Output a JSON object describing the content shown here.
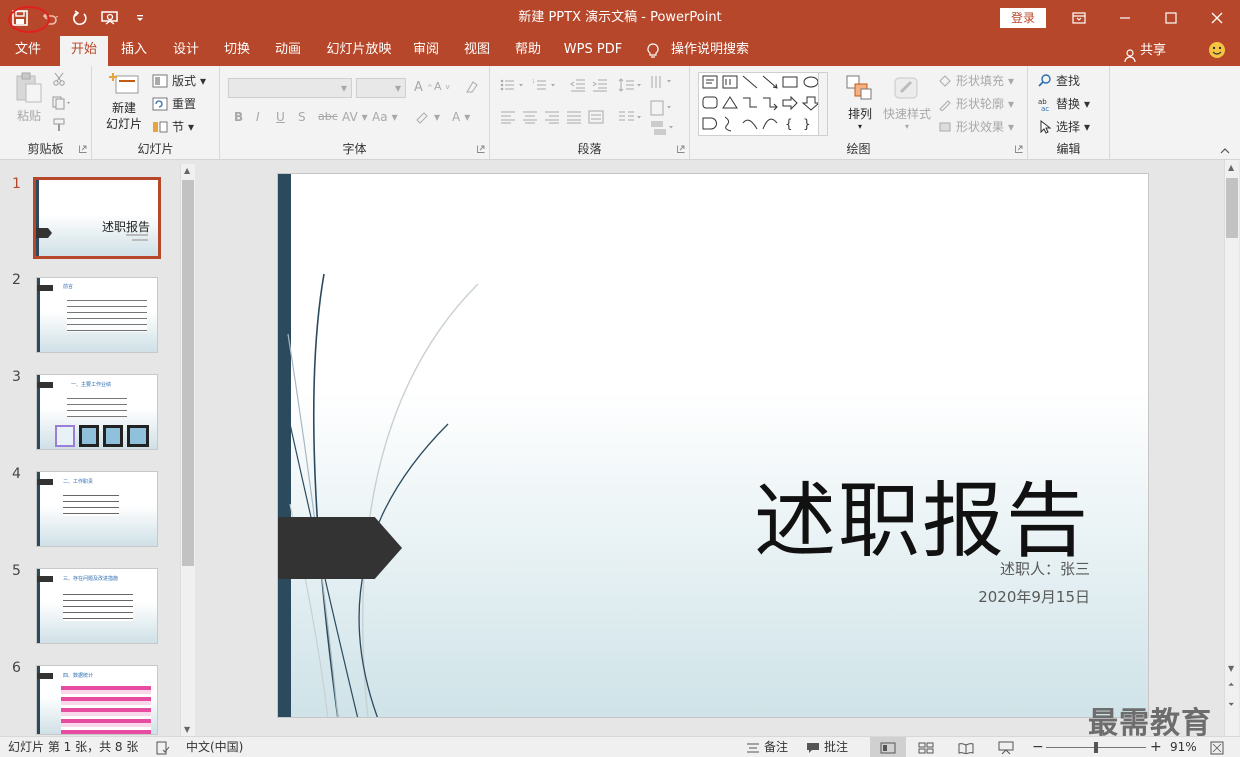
{
  "app": {
    "title": "新建 PPTX 演示文稿  -  PowerPoint",
    "login": "登录"
  },
  "qat": {
    "save": "save-icon",
    "undo": "undo-icon",
    "redo": "redo-icon",
    "present": "present-icon",
    "customize": "customize-icon"
  },
  "menu": {
    "tabs": [
      "文件",
      "开始",
      "插入",
      "设计",
      "切换",
      "动画",
      "幻灯片放映",
      "审阅",
      "视图",
      "帮助",
      "WPS PDF",
      "操作说明搜索"
    ],
    "active": "开始",
    "share": "共享"
  },
  "ribbon": {
    "clipboard": {
      "label": "剪贴板",
      "paste": "粘贴"
    },
    "slides": {
      "label": "幻灯片",
      "new_slide_1": "新建",
      "new_slide_2": "幻灯片",
      "layout": "版式",
      "reset": "重置",
      "section": "节"
    },
    "font": {
      "label": "字体",
      "bold": "B",
      "italic": "I",
      "underline": "U",
      "shadow": "S",
      "strike": "abc",
      "spacing": "AV",
      "case": "Aa",
      "fontcolor": "A"
    },
    "paragraph": {
      "label": "段落"
    },
    "drawing": {
      "label": "绘图",
      "arrange": "排列",
      "quick_styles": "快速样式",
      "shape_fill": "形状填充",
      "shape_outline": "形状轮廓",
      "shape_effects": "形状效果"
    },
    "editing": {
      "label": "编辑",
      "find": "查找",
      "replace": "替换",
      "select": "选择"
    }
  },
  "thumbnails": [
    {
      "num": "1",
      "title": "述职报告"
    },
    {
      "num": "2",
      "title": "前言"
    },
    {
      "num": "3",
      "title": "一、主要工作业绩"
    },
    {
      "num": "4",
      "title": "二、工作职责"
    },
    {
      "num": "5",
      "title": "三、存在问题及改进措施"
    },
    {
      "num": "6",
      "title": "四、数据统计"
    }
  ],
  "slide": {
    "title": "述职报告",
    "presenter": "述职人：张三",
    "date": "2020年9月15日"
  },
  "status": {
    "slide_info": "幻灯片 第 1 张，共 8 张",
    "language": "中文(中国)",
    "notes": "备注",
    "comments": "批注",
    "zoom": "91%",
    "zoom_level": 0.5
  },
  "watermark": "最需教育"
}
